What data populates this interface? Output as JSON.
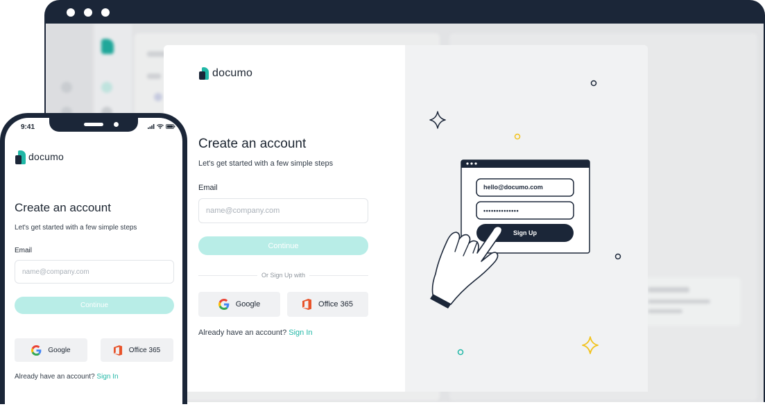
{
  "brand": {
    "name": "documo",
    "accent": "#20b7a6",
    "dark": "#1b2638"
  },
  "desktop": {
    "logo_text": "documo",
    "title": "Create an account",
    "subtitle": "Let's get started with a few simple steps",
    "email_label": "Email",
    "email_placeholder": "name@company.com",
    "continue_label": "Continue",
    "or_text": "Or Sign Up with",
    "google_label": "Google",
    "office_label": "Office 365",
    "already_text": "Already have an account?",
    "signin_label": "Sign In",
    "illustration": {
      "email_value": "hello@documo.com",
      "password_mask": "••••••••••••••",
      "signup_label": "Sign Up"
    }
  },
  "phone": {
    "time": "9:41",
    "logo_text": "documo",
    "title": "Create an account",
    "subtitle": "Let's get started with a few simple steps",
    "email_label": "Email",
    "email_placeholder": "name@company.com",
    "continue_label": "Continue",
    "google_label": "Google",
    "office_label": "Office 365",
    "already_text": "Already have an account?",
    "signin_label": "Sign In"
  }
}
